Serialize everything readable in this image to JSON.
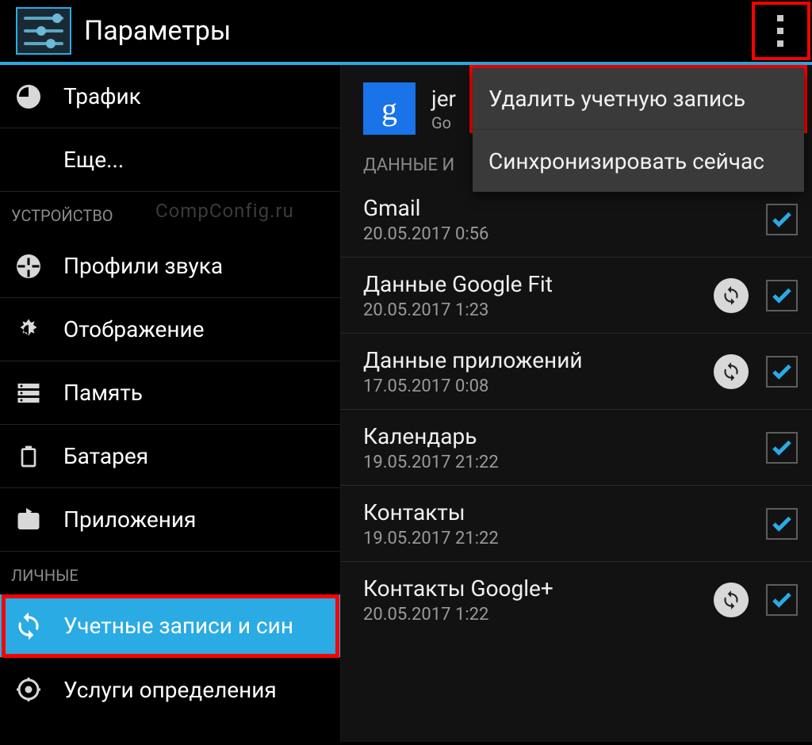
{
  "colors": {
    "accent": "#2aabe4",
    "highlight": "#ff0000"
  },
  "header": {
    "title": "Параметры",
    "overflow_icon": "more-vert-icon"
  },
  "watermark": "CompConfig.ru",
  "popup": {
    "items": [
      {
        "label": "Удалить учетную запись"
      },
      {
        "label": "Синхронизировать сейчас"
      }
    ]
  },
  "sidebar": {
    "top_items": [
      {
        "icon": "traffic-icon",
        "label": "Трафик"
      },
      {
        "icon": null,
        "label": "Еще..."
      }
    ],
    "section_device": "УСТРОЙСТВО",
    "device_items": [
      {
        "icon": "audio-profiles-icon",
        "label": "Профили звука"
      },
      {
        "icon": "display-icon",
        "label": "Отображение"
      },
      {
        "icon": "storage-icon",
        "label": "Память"
      },
      {
        "icon": "battery-icon",
        "label": "Батарея"
      },
      {
        "icon": "apps-icon",
        "label": "Приложения"
      }
    ],
    "section_personal": "ЛИЧНЫЕ",
    "personal_items": [
      {
        "icon": "sync-accounts-icon",
        "label": "Учетные записи и син",
        "selected": true
      },
      {
        "icon": "location-icon",
        "label": "Услуги определения"
      }
    ]
  },
  "account": {
    "logo_letter": "g",
    "name_visible": "jer",
    "sub_visible": "Go",
    "data_section_visible": "ДАННЫЕ И"
  },
  "sync_items": [
    {
      "title": "Gmail",
      "date": "20.05.2017 0:56",
      "has_sync_icon": false,
      "checked": true
    },
    {
      "title": "Данные Google Fit",
      "date": "20.05.2017 1:23",
      "has_sync_icon": true,
      "checked": true
    },
    {
      "title": "Данные приложений",
      "date": "17.05.2017 0:08",
      "has_sync_icon": true,
      "checked": true
    },
    {
      "title": "Календарь",
      "date": "19.05.2017 21:22",
      "has_sync_icon": false,
      "checked": true
    },
    {
      "title": "Контакты",
      "date": "19.05.2017 21:22",
      "has_sync_icon": false,
      "checked": true
    },
    {
      "title": "Контакты Google+",
      "date": "20.05.2017 1:22",
      "has_sync_icon": true,
      "checked": true
    }
  ]
}
